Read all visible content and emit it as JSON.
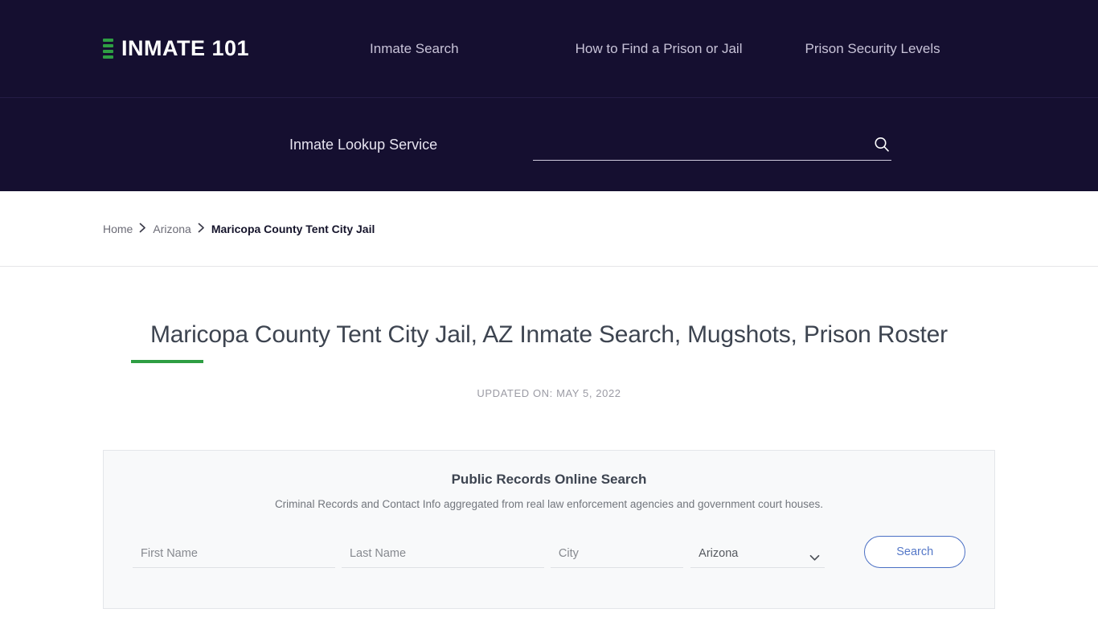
{
  "colors": {
    "header_bg": "#150f30",
    "accent_green": "#2e9e43",
    "button_blue": "#4a6fc4",
    "panel_bg": "#f8f9fa"
  },
  "header": {
    "brand": {
      "text": "INMATE 101",
      "icon": "list-bars-icon"
    },
    "nav": [
      {
        "label": "Inmate Search"
      },
      {
        "label": "How to Find a Prison or Jail"
      },
      {
        "label": "Prison Security Levels"
      }
    ],
    "search": {
      "tagline": "Inmate Lookup Service",
      "value": "",
      "placeholder": "",
      "icon": "search-icon"
    }
  },
  "breadcrumb": {
    "items": [
      {
        "label": "Home",
        "current": false
      },
      {
        "label": "Arizona",
        "current": false
      },
      {
        "label": "Maricopa County Tent City Jail",
        "current": true
      }
    ],
    "separator": "›"
  },
  "main": {
    "title": "Maricopa County Tent City Jail, AZ Inmate Search, Mugshots, Prison Roster",
    "updated": "UPDATED ON: MAY 5, 2022"
  },
  "records_panel": {
    "title": "Public Records Online Search",
    "subtitle": "Criminal Records and Contact Info aggregated from real law enforcement agencies and government court houses.",
    "fields": {
      "first_name": {
        "placeholder": "First Name",
        "value": ""
      },
      "last_name": {
        "placeholder": "Last Name",
        "value": ""
      },
      "city": {
        "placeholder": "City",
        "value": ""
      },
      "state": {
        "selected": "Arizona",
        "options": [
          "Arizona"
        ]
      }
    },
    "submit_label": "Search"
  }
}
